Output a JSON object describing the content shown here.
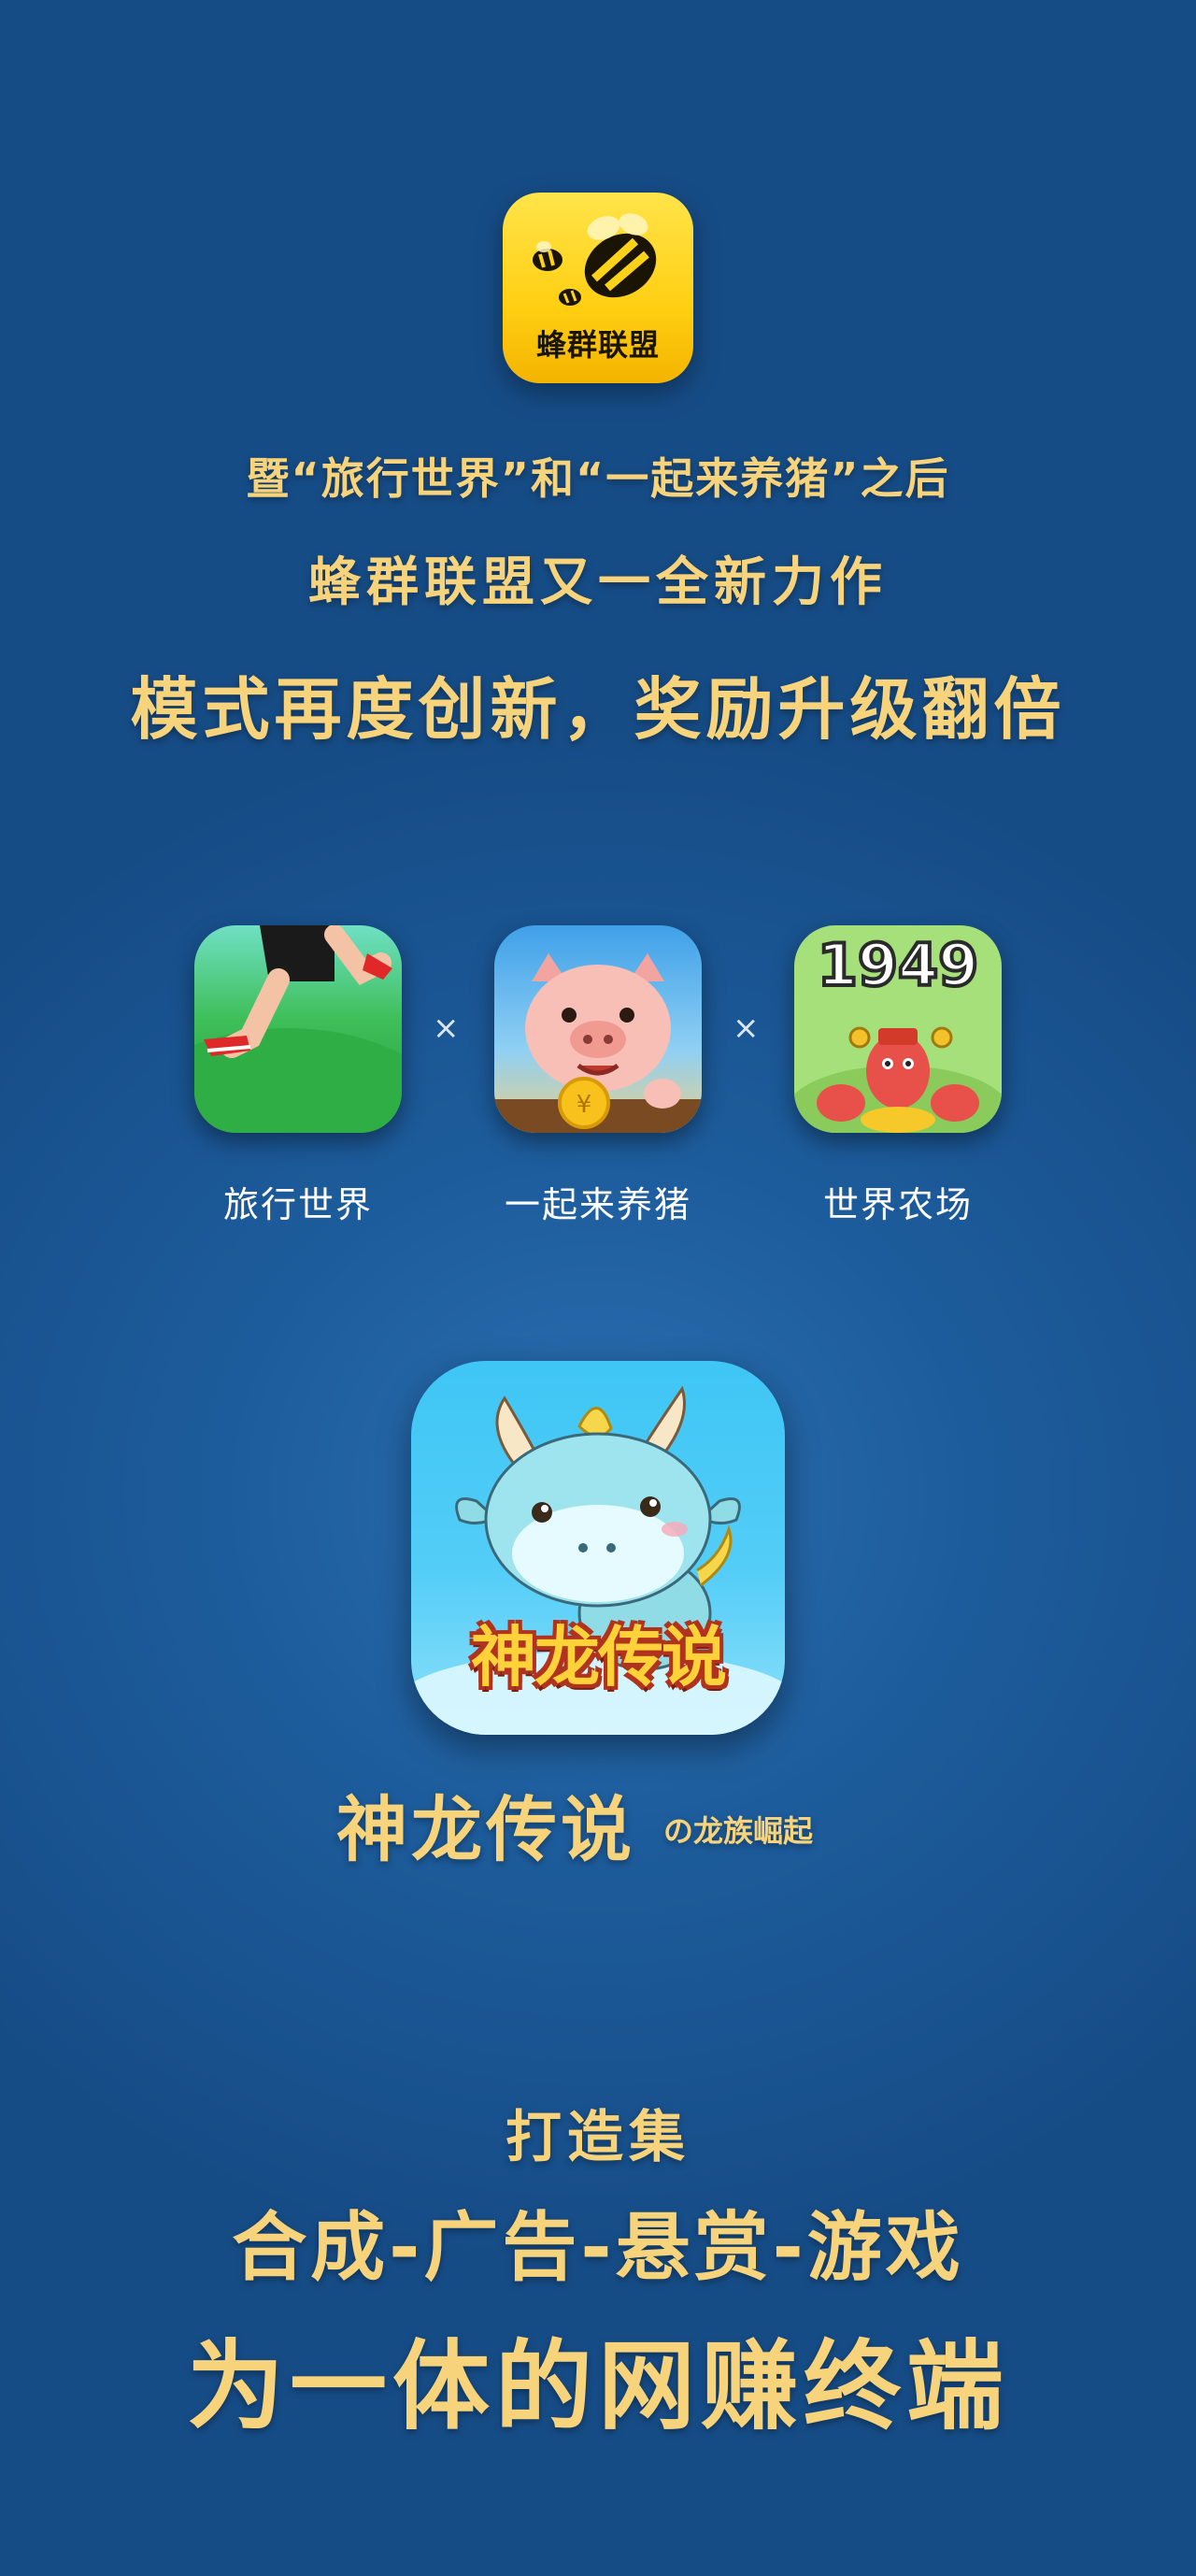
{
  "logo": {
    "text": "蜂群联盟",
    "icon": "bee-logo-icon"
  },
  "headline": {
    "line1": "暨“旅行世界”和“一起来养猪”之后",
    "line2": "蜂群联盟又一全新力作",
    "line3": "模式再度创新，奖励升级翻倍"
  },
  "apps": [
    {
      "label": "旅行世界",
      "icon": "running-legs-icon"
    },
    {
      "label": "一起来养猪",
      "icon": "pig-icon"
    },
    {
      "label": "世界农场",
      "icon": "lobster-1949-icon",
      "badge": "1949"
    }
  ],
  "separator": "×",
  "featured": {
    "icon_text": "神龙传说",
    "title": "神龙传说",
    "subtitle": "の龙族崛起"
  },
  "bottom": {
    "line1": "打造集",
    "line2": "合成-广告-悬赏-游戏",
    "line3": "为一体的网赚终端"
  },
  "colors": {
    "gold": "#f7d37c",
    "bg": "#1d5c9c"
  }
}
